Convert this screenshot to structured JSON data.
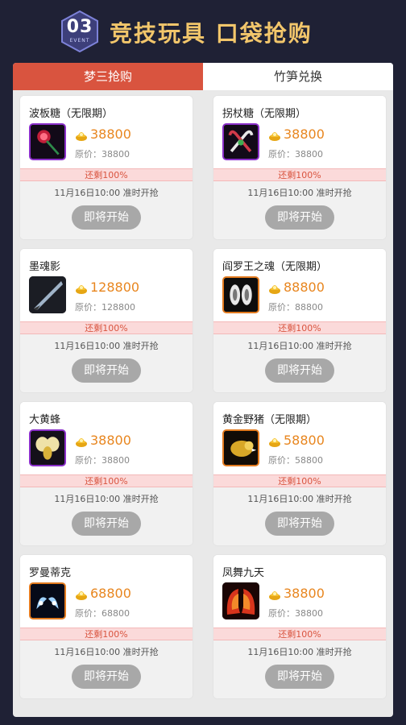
{
  "header": {
    "badge_number": "03",
    "badge_sub": "EVENT",
    "title": "竞技玩具  口袋抢购"
  },
  "tabs": [
    {
      "label": "梦三抢购",
      "active": true
    },
    {
      "label": "竹笋兑换",
      "active": false
    }
  ],
  "colors": {
    "accent": "#d9543f",
    "price": "#e8861f",
    "title_gold": "#f2c66b",
    "background": "#1f2135"
  },
  "items": [
    {
      "name": "波板糖（无限期）",
      "price": "38800",
      "orig": "原价：38800",
      "stock": "还剩100%",
      "time": "11月16日10:00 准时开抢",
      "button": "即将开始",
      "icon": "lollipop-icon",
      "frame": "purple"
    },
    {
      "name": "拐杖糖（无限期）",
      "price": "38800",
      "orig": "原价：38800",
      "stock": "还剩100%",
      "time": "11月16日10:00 准时开抢",
      "button": "即将开始",
      "icon": "candy-cane-icon",
      "frame": "purple"
    },
    {
      "name": "墨魂影",
      "price": "128800",
      "orig": "原价：128800",
      "stock": "还剩100%",
      "time": "11月16日10:00 准时开抢",
      "button": "即将开始",
      "icon": "blade-icon",
      "frame": "blank"
    },
    {
      "name": "阎罗王之魂（无限期）",
      "price": "88800",
      "orig": "原价：88800",
      "stock": "还剩100%",
      "time": "11月16日10:00 准时开抢",
      "button": "即将开始",
      "icon": "soul-icon",
      "frame": "orange"
    },
    {
      "name": "大黄蜂",
      "price": "38800",
      "orig": "原价：38800",
      "stock": "还剩100%",
      "time": "11月16日10:00 准时开抢",
      "button": "即将开始",
      "icon": "bee-icon",
      "frame": "purple"
    },
    {
      "name": "黄金野猪（无限期）",
      "price": "58800",
      "orig": "原价：58800",
      "stock": "还剩100%",
      "time": "11月16日10:00 准时开抢",
      "button": "即将开始",
      "icon": "golden-boar-icon",
      "frame": "orange"
    },
    {
      "name": "罗曼蒂克",
      "price": "68800",
      "orig": "原价：68800",
      "stock": "还剩100%",
      "time": "11月16日10:00 准时开抢",
      "button": "即将开始",
      "icon": "romantic-wings-icon",
      "frame": "orange"
    },
    {
      "name": "凤舞九天",
      "price": "38800",
      "orig": "原价：38800",
      "stock": "还剩100%",
      "time": "11月16日10:00 准时开抢",
      "button": "即将开始",
      "icon": "phoenix-wings-icon",
      "frame": "blank"
    }
  ]
}
